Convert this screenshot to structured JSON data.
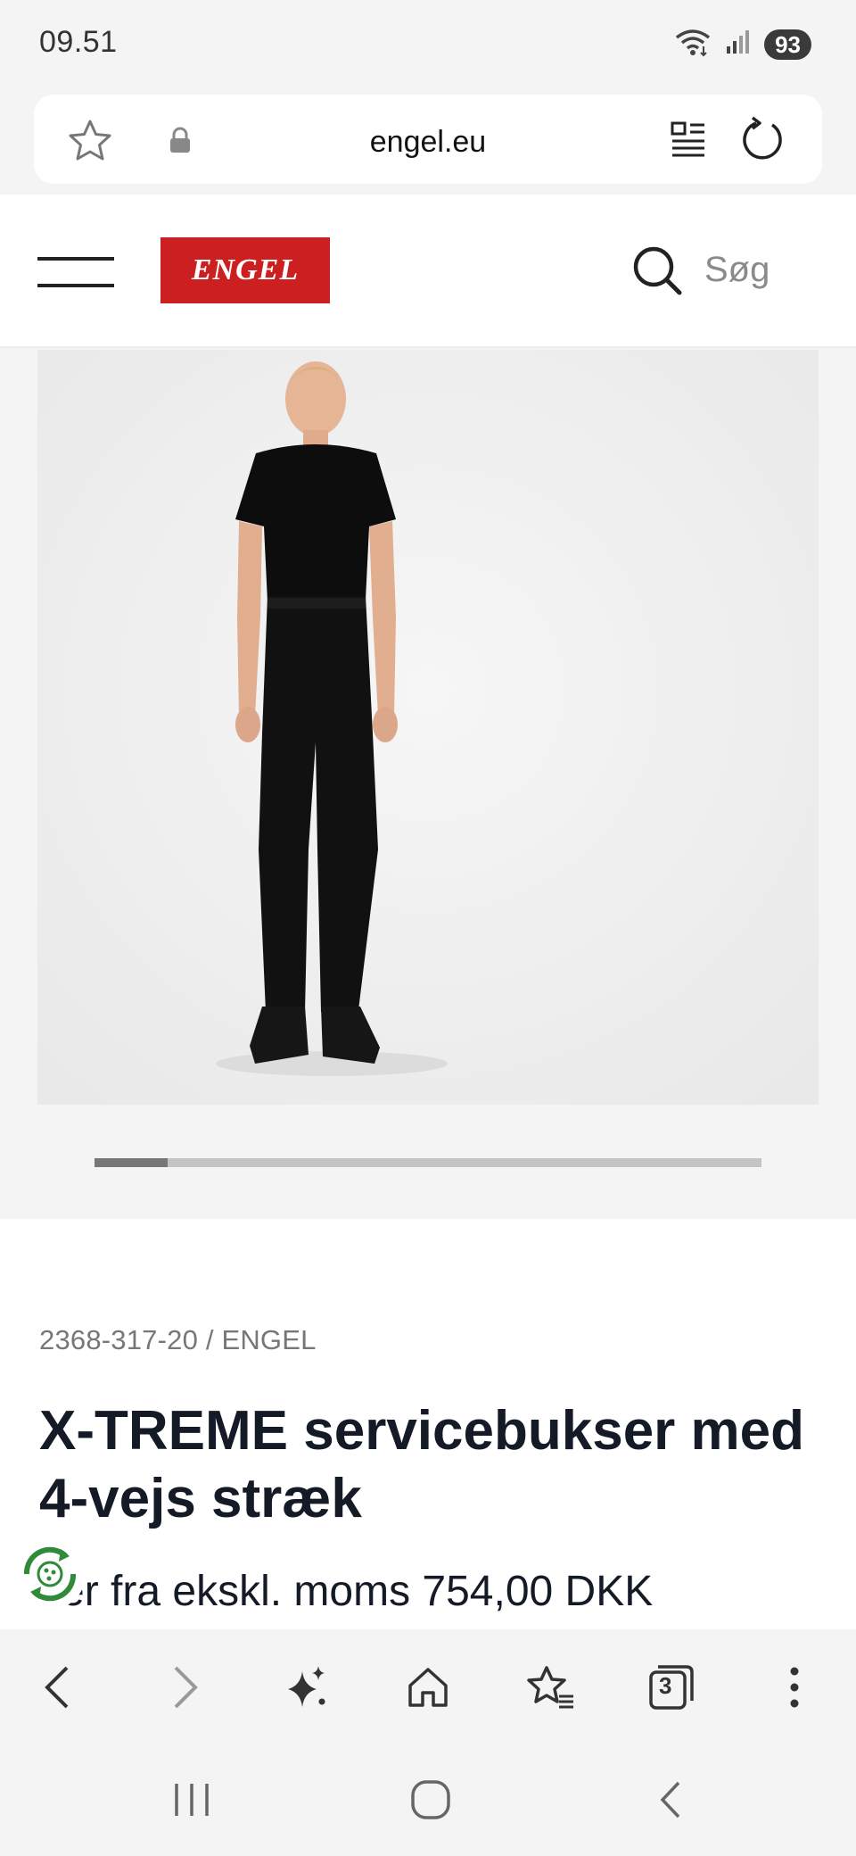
{
  "status_bar": {
    "time": "09.51",
    "battery": "93",
    "icons": [
      "wifi-icon",
      "signal-icon",
      "battery-icon"
    ]
  },
  "browser": {
    "url": "engel.eu",
    "icons": [
      "bookmark-star-icon",
      "lock-icon",
      "reader-mode-icon",
      "reload-icon"
    ]
  },
  "site_header": {
    "logo_text": "ENGEL",
    "search_label": "Søg",
    "brand_color": "#cc1f1f"
  },
  "gallery": {
    "image_alt": "Man wearing black t-shirt and black X-TREME service trousers",
    "progress_fraction": 0.11
  },
  "product": {
    "sku_line": "2368-317-20 / ENGEL",
    "title": "X-TREME servicebukser med 4-vejs stræk",
    "price_line": "ser fra ekskl. moms 754,00 DKK"
  },
  "bottom_toolbar": {
    "items": [
      "back-icon",
      "forward-icon",
      "ai-sparkle-icon",
      "home-icon",
      "bookmarks-icon",
      "tabs-icon",
      "more-icon"
    ],
    "tab_count": "3"
  },
  "nav_bar": {
    "items": [
      "recents-icon",
      "home-circle-icon",
      "nav-back-icon"
    ]
  }
}
